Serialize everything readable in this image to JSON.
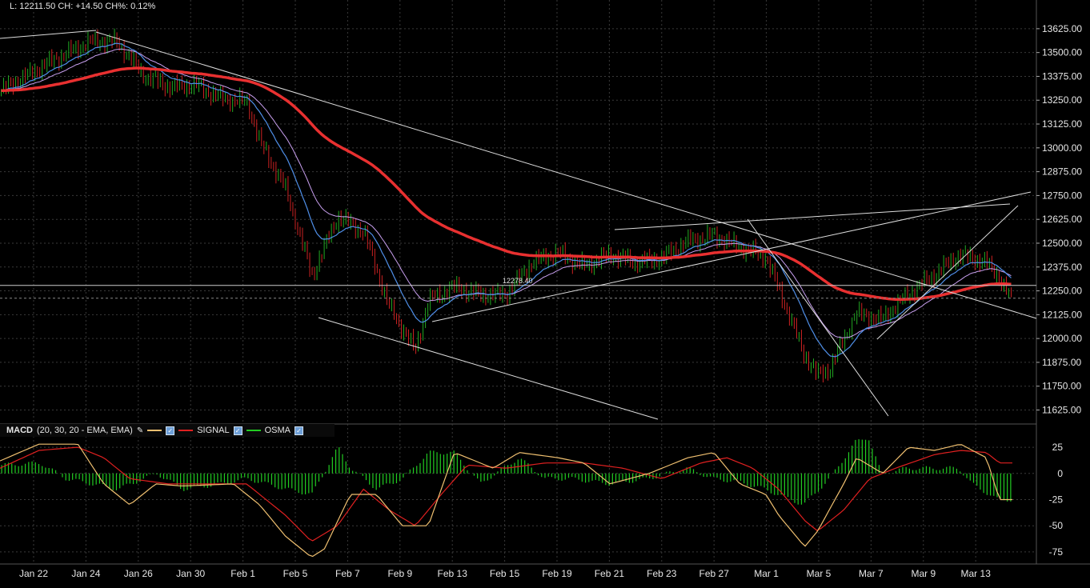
{
  "header": {
    "text": "L: 12211.50 CH: +14.50 CH%: 0.12%"
  },
  "price_label": "12278.40",
  "macd_legend": {
    "name": "MACD",
    "params": "(20, 30, 20 - EMA, EMA)",
    "signal_label": "SIGNAL",
    "osma_label": "OSMA"
  },
  "colors": {
    "background": "#000000",
    "grid": "#3a3a3a",
    "up": "#22aa22",
    "down": "#cc2222",
    "ema_fast": "#4f8fe8",
    "ema_slow": "#c9a0f0",
    "ma_long": "#e83030",
    "macd": "#f0c070",
    "signal": "#e02020",
    "osma": "#22cc22"
  },
  "chart_data": [
    {
      "type": "candlestick",
      "x_tick_labels": [
        "Jan 22",
        "Jan 24",
        "Jan 26",
        "Jan 30",
        "Feb 1",
        "Feb 5",
        "Feb 7",
        "Feb 9",
        "Feb 13",
        "Feb 15",
        "Feb 19",
        "Feb 21",
        "Feb 23",
        "Feb 27",
        "Mar 1",
        "Mar 5",
        "Mar 7",
        "Mar 9",
        "Mar 13"
      ],
      "y_tick_labels": [
        "13625.00",
        "13500.00",
        "13375.00",
        "13250.00",
        "13125.00",
        "13000.00",
        "12875.00",
        "12750.00",
        "12625.00",
        "12500.00",
        "12375.00",
        "12250.00",
        "12125.00",
        "12000.00",
        "11875.00",
        "11750.00",
        "11625.00"
      ],
      "ylim": [
        11560,
        13700
      ],
      "last_close": 12211.5,
      "hline": 12278.4,
      "close_path": [
        [
          0,
          13300
        ],
        [
          4,
          13460
        ],
        [
          7,
          13560
        ],
        [
          9,
          13555
        ],
        [
          11,
          13380
        ],
        [
          13,
          13320
        ],
        [
          15,
          13330
        ],
        [
          17,
          13260
        ],
        [
          19,
          13240
        ],
        [
          20,
          13030
        ],
        [
          22,
          12780
        ],
        [
          24,
          12330
        ],
        [
          26,
          12640
        ],
        [
          28,
          12560
        ],
        [
          30,
          12160
        ],
        [
          32,
          11940
        ],
        [
          33,
          12200
        ],
        [
          35,
          12270
        ],
        [
          37,
          12230
        ],
        [
          39,
          12230
        ],
        [
          41,
          12400
        ],
        [
          43,
          12450
        ],
        [
          45,
          12380
        ],
        [
          47,
          12440
        ],
        [
          49,
          12400
        ],
        [
          51,
          12420
        ],
        [
          53,
          12510
        ],
        [
          55,
          12540
        ],
        [
          57,
          12480
        ],
        [
          59,
          12430
        ],
        [
          60,
          12270
        ],
        [
          62,
          11920
        ],
        [
          63,
          11810
        ],
        [
          64,
          11840
        ],
        [
          66,
          12130
        ],
        [
          68,
          12100
        ],
        [
          70,
          12230
        ],
        [
          72,
          12330
        ],
        [
          74,
          12440
        ],
        [
          76,
          12400
        ],
        [
          77,
          12330
        ],
        [
          78,
          12200
        ]
      ],
      "series": [
        {
          "name": "MACD",
          "values": [
            [
              0,
              12
            ],
            [
              3,
              28
            ],
            [
              6,
              28
            ],
            [
              8,
              -10
            ],
            [
              10,
              -30
            ],
            [
              12,
              -10
            ],
            [
              14,
              -12
            ],
            [
              18,
              -10
            ],
            [
              20,
              -30
            ],
            [
              22,
              -60
            ],
            [
              24,
              -80
            ],
            [
              25,
              -72
            ],
            [
              27,
              -20
            ],
            [
              29,
              -20
            ],
            [
              31,
              -50
            ],
            [
              33,
              -50
            ],
            [
              35,
              20
            ],
            [
              38,
              5
            ],
            [
              40,
              20
            ],
            [
              43,
              15
            ],
            [
              45,
              10
            ],
            [
              47,
              -10
            ],
            [
              50,
              0
            ],
            [
              53,
              15
            ],
            [
              55,
              20
            ],
            [
              57,
              -10
            ],
            [
              59,
              -20
            ],
            [
              60,
              -40
            ],
            [
              62,
              -70
            ],
            [
              63,
              -55
            ],
            [
              65,
              -10
            ],
            [
              66,
              15
            ],
            [
              68,
              0
            ],
            [
              70,
              25
            ],
            [
              72,
              22
            ],
            [
              74,
              28
            ],
            [
              76,
              15
            ],
            [
              77,
              -25
            ]
          ]
        },
        {
          "name": "SIGNAL",
          "values": [
            [
              0,
              5
            ],
            [
              3,
              22
            ],
            [
              6,
              25
            ],
            [
              8,
              15
            ],
            [
              10,
              -5
            ],
            [
              13,
              -10
            ],
            [
              16,
              -10
            ],
            [
              19,
              -10
            ],
            [
              22,
              -40
            ],
            [
              24,
              -65
            ],
            [
              26,
              -50
            ],
            [
              28,
              -15
            ],
            [
              30,
              -35
            ],
            [
              32,
              -50
            ],
            [
              34,
              -20
            ],
            [
              36,
              8
            ],
            [
              39,
              5
            ],
            [
              42,
              10
            ],
            [
              45,
              10
            ],
            [
              48,
              5
            ],
            [
              51,
              -5
            ],
            [
              54,
              10
            ],
            [
              56,
              15
            ],
            [
              58,
              5
            ],
            [
              60,
              -15
            ],
            [
              62,
              -45
            ],
            [
              63,
              -55
            ],
            [
              65,
              -35
            ],
            [
              67,
              -5
            ],
            [
              69,
              5
            ],
            [
              72,
              18
            ],
            [
              74,
              22
            ],
            [
              76,
              20
            ],
            [
              77,
              10
            ]
          ]
        },
        {
          "name": "OSMA",
          "values": [
            [
              0,
              8
            ],
            [
              3,
              10
            ],
            [
              5,
              -5
            ],
            [
              7,
              -10
            ],
            [
              9,
              -15
            ],
            [
              12,
              0
            ],
            [
              14,
              -15
            ],
            [
              17,
              -10
            ],
            [
              19,
              -5
            ],
            [
              22,
              -15
            ],
            [
              24,
              -20
            ],
            [
              26,
              25
            ],
            [
              27,
              5
            ],
            [
              29,
              -15
            ],
            [
              31,
              -5
            ],
            [
              33,
              20
            ],
            [
              35,
              20
            ],
            [
              37,
              -10
            ],
            [
              40,
              15
            ],
            [
              42,
              -5
            ],
            [
              44,
              -5
            ],
            [
              47,
              -10
            ],
            [
              50,
              -5
            ],
            [
              53,
              5
            ],
            [
              55,
              -5
            ],
            [
              57,
              -8
            ],
            [
              59,
              -15
            ],
            [
              61,
              -25
            ],
            [
              62,
              -30
            ],
            [
              64,
              -5
            ],
            [
              66,
              30
            ],
            [
              67,
              35
            ],
            [
              68,
              0
            ],
            [
              70,
              5
            ],
            [
              72,
              5
            ],
            [
              74,
              5
            ],
            [
              75,
              -10
            ],
            [
              77,
              -25
            ]
          ]
        }
      ]
    },
    {
      "type": "line",
      "y_tick_labels": [
        "25",
        "0",
        "-25",
        "-50",
        "-75"
      ],
      "ylim": [
        -85,
        35
      ]
    }
  ]
}
